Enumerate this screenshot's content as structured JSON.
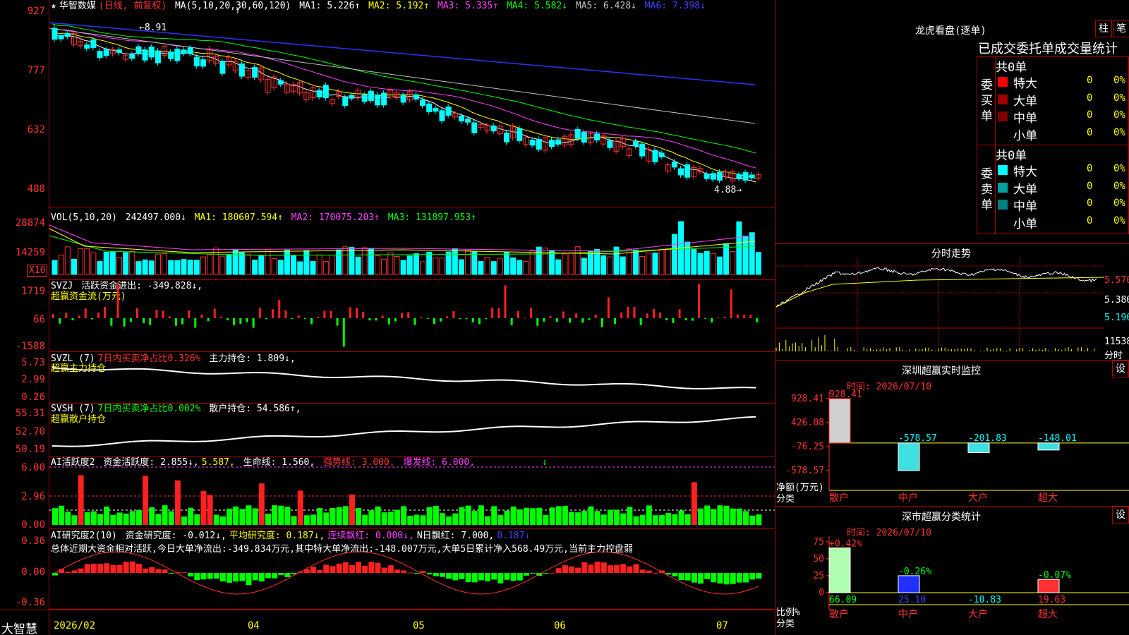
{
  "stock": {
    "star": "★",
    "name": "华智数媒",
    "period": "(日线, 前复权)",
    "cursor": "↑"
  },
  "ma": {
    "label": "MA(5,10,20,30,60,120)",
    "ma1": "MA1: 5.226↑",
    "ma2": "MA2: 5.192↑",
    "ma3": "MA3: 5.335↑",
    "ma4": "MA4: 5.582↓",
    "ma5": "MA5: 6.428↓",
    "ma6": "MA6: 7.398↓",
    "high_mark": "←8.91",
    "low_mark": "4.88→"
  },
  "price_axis": [
    "927",
    "777",
    "632",
    "488"
  ],
  "vol": {
    "label": "VOL(5,10,20)",
    "value": "242497.000↓",
    "ma1": "MA1: 180607.594↑",
    "ma2": "MA2: 170075.203↑",
    "ma3": "MA3: 131897.953↑",
    "axis": [
      "28874",
      "14259"
    ],
    "unit": "X10"
  },
  "svzj": {
    "label": "SVZJ",
    "desc": "活跃资金进出: -349.828↓,",
    "sub": "超赢资金流(万元)",
    "axis": [
      "1719",
      "66",
      "-1588"
    ]
  },
  "svzl": {
    "label": "SVZL (7)",
    "desc": "7日内买卖净占比0.326%",
    "hold": "主力持仓: 1.809↓,",
    "sub": "超赢主力持仓",
    "axis": [
      "5.73",
      "2.99",
      "0.26"
    ]
  },
  "svsh": {
    "label": "SVSH (7)",
    "desc": "7日内买卖净占比0.002%",
    "hold": "散户持仓: 54.586↑,",
    "sub": "超赢散户持仓",
    "axis": [
      "55.31",
      "52.70",
      "50.19"
    ]
  },
  "ai1": {
    "label": "AI活跃度2",
    "a": "资金活跃度: 2.855↓,",
    "b": "5.587,",
    "c": "生命线: 1.560,",
    "d": "强势线: 3.000,",
    "e": "爆发线: 6.000,",
    "arrow": "↓",
    "axis": [
      "6.00",
      "2.96",
      "0.00"
    ]
  },
  "ai2": {
    "label": "AI研究度2(10)",
    "a": "资金研究度: -0.012↓,",
    "b": "平均研究度: 0.187↓,",
    "c": "连续飘红: 0.000↓,",
    "d": "N日飘红: 7.000,",
    "e": "0.187↓",
    "summary": "总体近期大资金相对活跃,今日大单净流出:-349.834万元,其中特大单净流出:-148.007万元,大单5日累计净入568.49万元,当前主力控盘弱",
    "axis": [
      "0.36",
      "0.00",
      "-0.36"
    ]
  },
  "xaxis": [
    "2026/02",
    "04",
    "05",
    "06",
    "07"
  ],
  "bottom_left": "大智慧",
  "right": {
    "lhb_title": "龙虎看盘(逐单)",
    "btn_zhu": "柱",
    "btn_bi": "笔",
    "stats_title": "已成交委托单成交量统计",
    "buy_label": "委买单",
    "sell_label": "委卖单",
    "buy_total": "共0单",
    "sell_total": "共0单",
    "buy_rows": [
      {
        "name": "特大",
        "count": "0",
        "pct": "0%",
        "color": "#ff0000"
      },
      {
        "name": "大单",
        "count": "0",
        "pct": "0%",
        "color": "#a00000"
      },
      {
        "name": "中单",
        "count": "0",
        "pct": "0%",
        "color": "#800000"
      },
      {
        "name": "小单",
        "count": "0",
        "pct": "0%",
        "color": "#000000"
      }
    ],
    "sell_rows": [
      {
        "name": "特大",
        "count": "0",
        "pct": "0%",
        "color": "#00ffff"
      },
      {
        "name": "大单",
        "count": "0",
        "pct": "0%",
        "color": "#00a0a0"
      },
      {
        "name": "中单",
        "count": "0",
        "pct": "0%",
        "color": "#008080"
      },
      {
        "name": "小单",
        "count": "0",
        "pct": "0%",
        "color": "#000000"
      }
    ],
    "fenshi_title": "分时走势",
    "fenshi_axis": [
      "5.570",
      "5.380",
      "5.190",
      "11538",
      "分时"
    ],
    "sz_title": "深圳超赢实时监控",
    "btn_set": "设",
    "sz_time": "时间: 2026/07/10",
    "sz_axis": [
      "928.41",
      "426.08",
      "-76.25",
      "-578.57"
    ],
    "sz_unit": "净额(万元)",
    "sz_cat_label": "分类",
    "sz_bars": [
      {
        "cat": "散户",
        "value": 928.41,
        "label": "928.41"
      },
      {
        "cat": "中户",
        "value": -578.57,
        "label": "-578.57"
      },
      {
        "cat": "大户",
        "value": -201.83,
        "label": "-201.83"
      },
      {
        "cat": "超大",
        "value": -148.01,
        "label": "-148.01"
      }
    ],
    "ss_title": "深市超赢分类统计",
    "ss_time": "时间: 2026/07/10",
    "ss_axis": [
      "75",
      "50",
      "25",
      "0"
    ],
    "ss_unit": "比例%",
    "ss_cat_label": "分类",
    "ss_bars": [
      {
        "cat": "散户",
        "value": 66.09,
        "label": "66.09",
        "top": "+0.42%"
      },
      {
        "cat": "中户",
        "value": 25.1,
        "label": "25.10",
        "top": "-0.26%"
      },
      {
        "cat": "大户",
        "value": -10.83,
        "label": "-10.83",
        "top": ""
      },
      {
        "cat": "超大",
        "value": 19.63,
        "label": "19.63",
        "top": "-0.07%"
      }
    ]
  }
}
